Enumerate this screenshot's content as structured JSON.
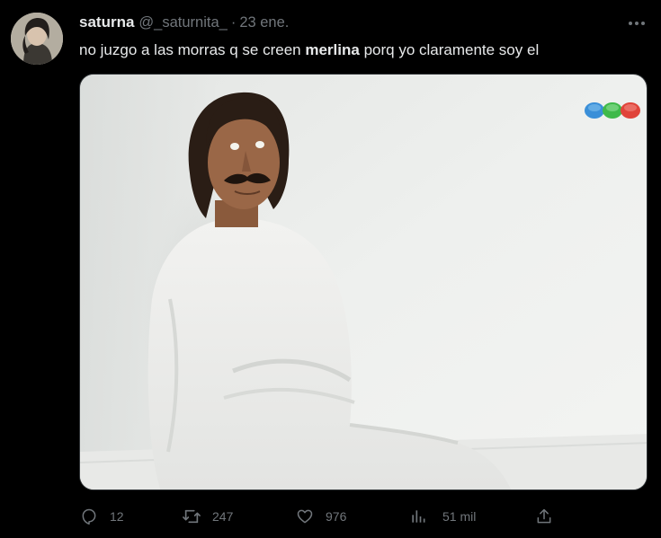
{
  "tweet": {
    "display_name": "saturna",
    "handle": "@_saturnita_",
    "separator": "·",
    "date": "23 ene.",
    "text_before": "no juzgo a las morras q se creen ",
    "text_bold": "merlina",
    "text_after": " porq yo claramente soy el"
  },
  "actions": {
    "reply_count": "12",
    "retweet_count": "247",
    "like_count": "976",
    "views_count": "51 mil"
  },
  "icons": {
    "more": "more-icon",
    "reply": "reply-icon",
    "retweet": "retweet-icon",
    "like": "heart-icon",
    "views": "views-icon",
    "share": "share-icon"
  },
  "colors": {
    "background": "#000000",
    "text": "#e7e9ea",
    "secondary_text": "#71767b",
    "border": "#2f3336"
  }
}
